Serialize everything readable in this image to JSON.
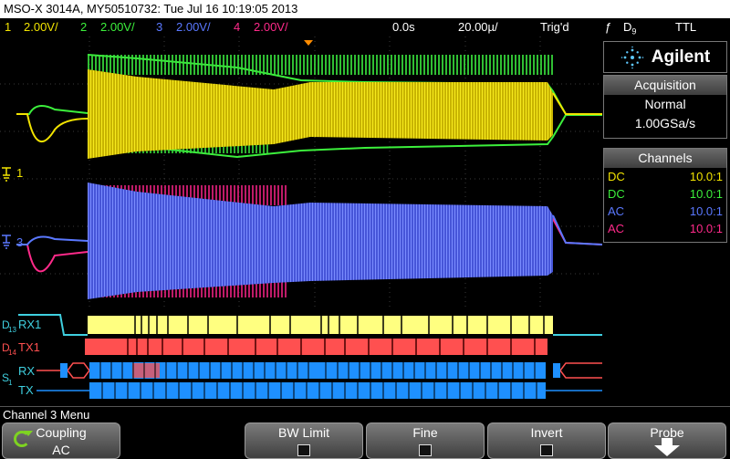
{
  "title": "MSO-X 3014A, MY50510732: Tue Jul 16 10:19:05 2013",
  "status": {
    "channels": [
      {
        "num": "1",
        "scale": "2.00V/",
        "color": "#f2e400"
      },
      {
        "num": "2",
        "scale": "2.00V/",
        "color": "#3cf03c"
      },
      {
        "num": "3",
        "scale": "2.00V/",
        "color": "#5a78ff"
      },
      {
        "num": "4",
        "scale": "2.00V/",
        "color": "#ff2a8a"
      }
    ],
    "delay": "0.0s",
    "timebase": "20.00µ/",
    "trigger_state": "Trig'd",
    "trigger_source": "D",
    "trigger_source_sub": "9",
    "trigger_level": "TTL"
  },
  "brand": {
    "name": "Agilent",
    "logo_icon": "agilent-spark-icon"
  },
  "acquisition": {
    "heading": "Acquisition",
    "mode": "Normal",
    "rate": "1.00GSa/s"
  },
  "channels_panel": {
    "heading": "Channels",
    "rows": [
      {
        "coupling": "DC",
        "ratio": "10.0:1",
        "color": "#f2e400"
      },
      {
        "coupling": "DC",
        "ratio": "10.0:1",
        "color": "#3cf03c"
      },
      {
        "coupling": "AC",
        "ratio": "10.0:1",
        "color": "#5a78ff"
      },
      {
        "coupling": "AC",
        "ratio": "10.0:1",
        "color": "#ff2a8a"
      }
    ]
  },
  "traces": {
    "ch1_marker": "1",
    "ch3_marker": "3",
    "digital": [
      {
        "prefix": "D",
        "sub": "13",
        "label": "RX1",
        "color": "#3fd0e0",
        "bus_color": "#ffff80"
      },
      {
        "prefix": "D",
        "sub": "14",
        "label": "TX1",
        "color": "#ff5050",
        "bus_color": "#ff5050"
      }
    ],
    "serial": {
      "prefix": "S",
      "sub": "1",
      "rx_label": "RX",
      "tx_label": "TX",
      "bus_color": "#1e90ff"
    }
  },
  "menu": {
    "title": "Channel 3 Menu",
    "softkeys": [
      {
        "label": "Coupling",
        "value": "AC",
        "icon": "refresh-icon"
      },
      {
        "label": "BW Limit",
        "checked": false
      },
      {
        "label": "Fine",
        "checked": false
      },
      {
        "label": "Invert",
        "checked": false
      },
      {
        "label": "Probe",
        "icon": "down-arrow-icon"
      }
    ]
  }
}
